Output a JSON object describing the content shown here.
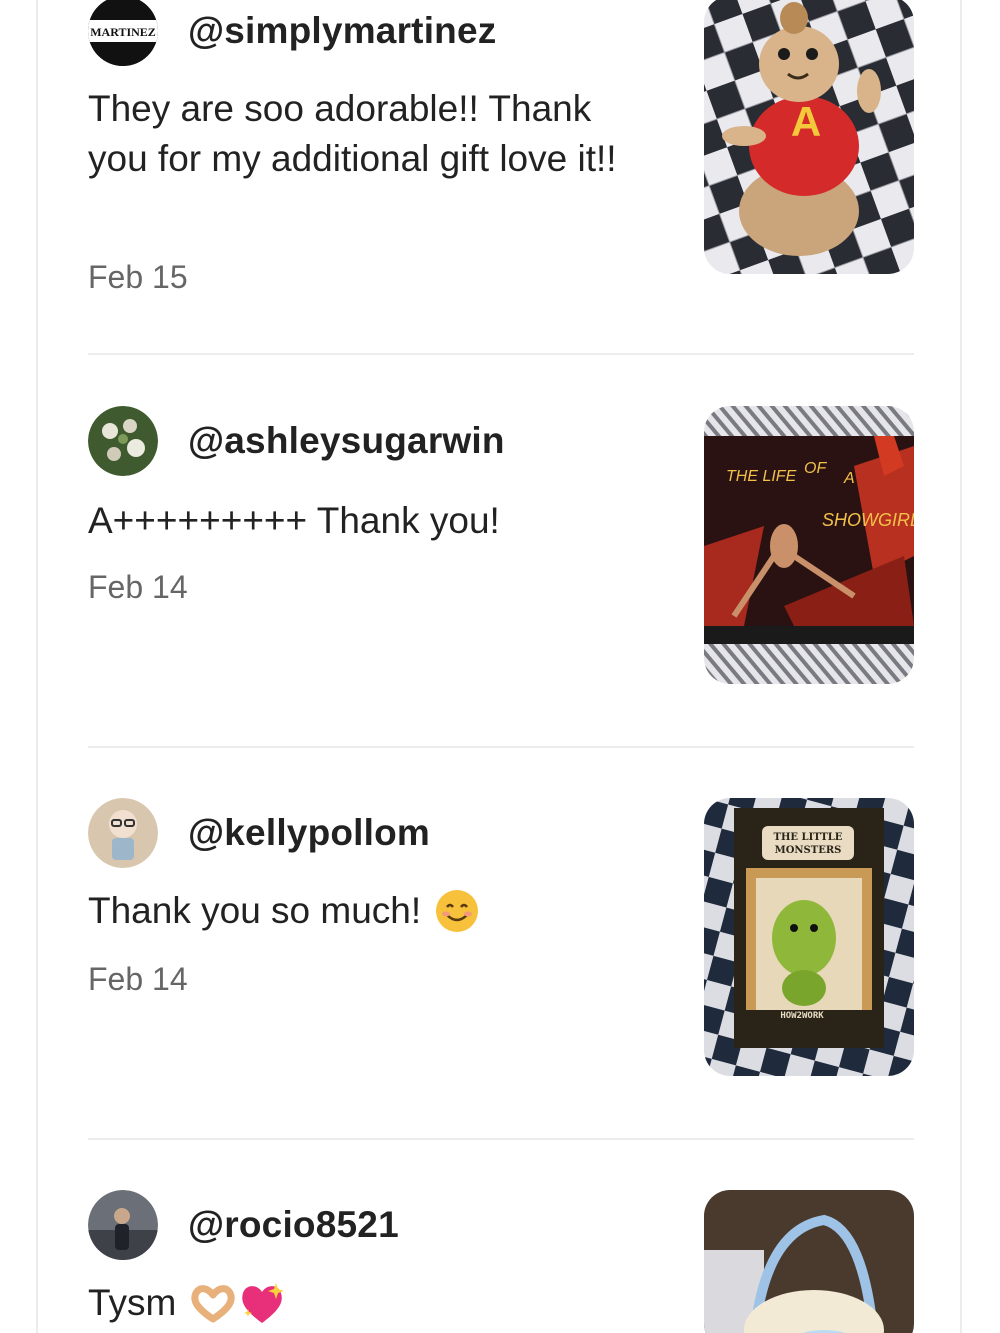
{
  "reviews": [
    {
      "username": "@simplymartinez",
      "text": "They are soo adorable!! Thank you for my additional gift love it!!",
      "date": "Feb 15",
      "avatar_text": "MARTINEZ",
      "photo_icon": "chipmunk-plush-photo",
      "photo_letter": "A"
    },
    {
      "username": "@ashleysugarwin",
      "text": "A+++++++++ Thank you!",
      "date": "Feb 14",
      "avatar_icon": "flowers-avatar",
      "photo_icon": "album-cover-photo",
      "photo_texts": [
        "THE LIFE",
        "OF",
        "A",
        "SHOWGIRL"
      ]
    },
    {
      "username": "@kellypollom",
      "text": "Thank you so much!",
      "date": "Feb 14",
      "avatar_icon": "figurine-avatar",
      "text_emoji_icon": "smiling-face-icon",
      "photo_icon": "boxed-figure-photo",
      "photo_texts": [
        "THE LITTLE",
        "MONSTERS",
        "HOW2WORK"
      ]
    },
    {
      "username": "@rocio8521",
      "text": "Tysm",
      "avatar_icon": "person-avatar",
      "text_emoji_icons": [
        "heart-hands-icon",
        "sparkling-heart-icon"
      ],
      "photo_icon": "plush-bag-photo"
    }
  ],
  "colors": {
    "text": "#222222",
    "date": "#666666",
    "divider": "#ececec"
  }
}
